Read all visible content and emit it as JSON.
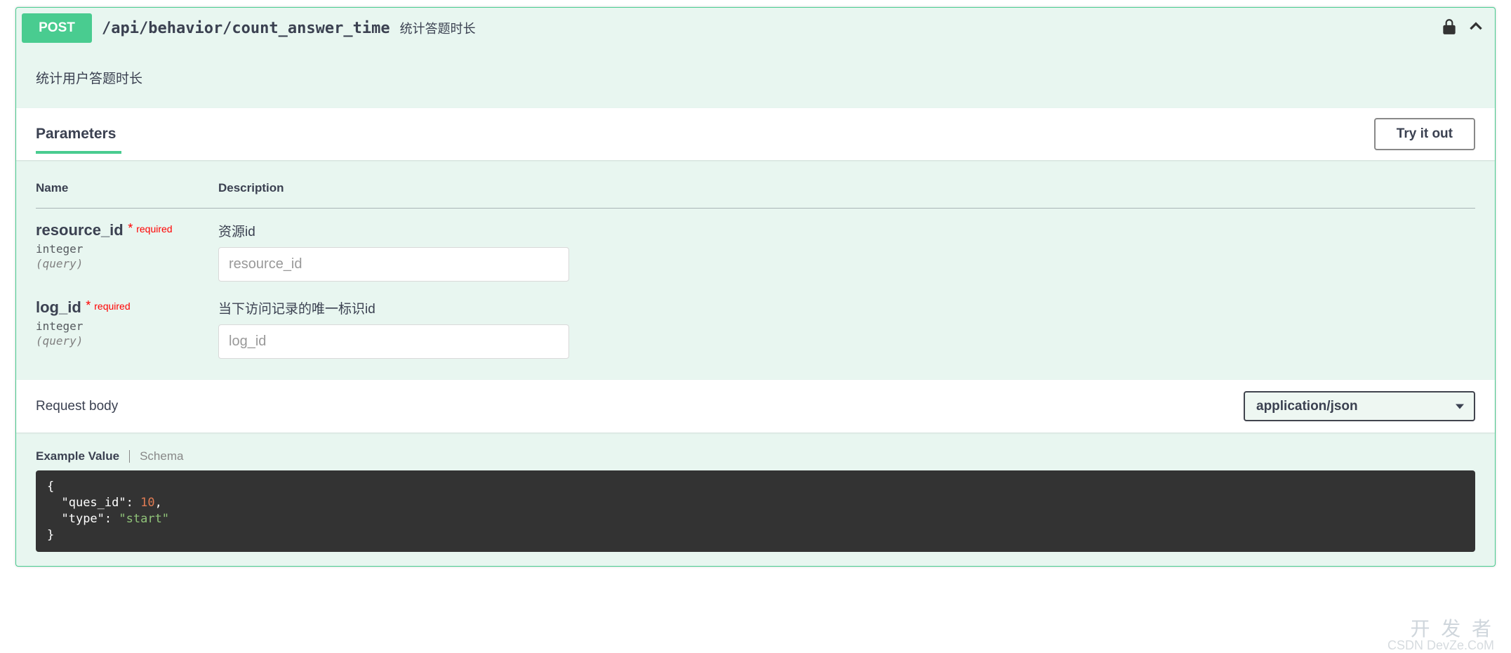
{
  "opblock": {
    "method": "POST",
    "path": "/api/behavior/count_answer_time",
    "summary": "统计答题时长",
    "description": "统计用户答题时长"
  },
  "sections": {
    "parameters_title": "Parameters",
    "try_it_out": "Try it out",
    "request_body": "Request body"
  },
  "content_type": {
    "selected": "application/json"
  },
  "table_headers": {
    "name": "Name",
    "description": "Description"
  },
  "params": [
    {
      "name": "resource_id",
      "required_label": "required",
      "type": "integer",
      "in": "(query)",
      "description": "资源id",
      "placeholder": "resource_id"
    },
    {
      "name": "log_id",
      "required_label": "required",
      "type": "integer",
      "in": "(query)",
      "description": "当下访问记录的唯一标识id",
      "placeholder": "log_id"
    }
  ],
  "body_tabs": {
    "example": "Example Value",
    "schema": "Schema"
  },
  "example_json": {
    "line_open": "{",
    "line1_key": "\"ques_id\"",
    "line1_sep": ": ",
    "line1_val": "10",
    "line1_end": ",",
    "line2_key": "\"type\"",
    "line2_sep": ": ",
    "line2_val": "\"start\"",
    "line_close": "}"
  },
  "watermark": "开 发 者",
  "watermark2": "CSDN DevZe.CoM"
}
